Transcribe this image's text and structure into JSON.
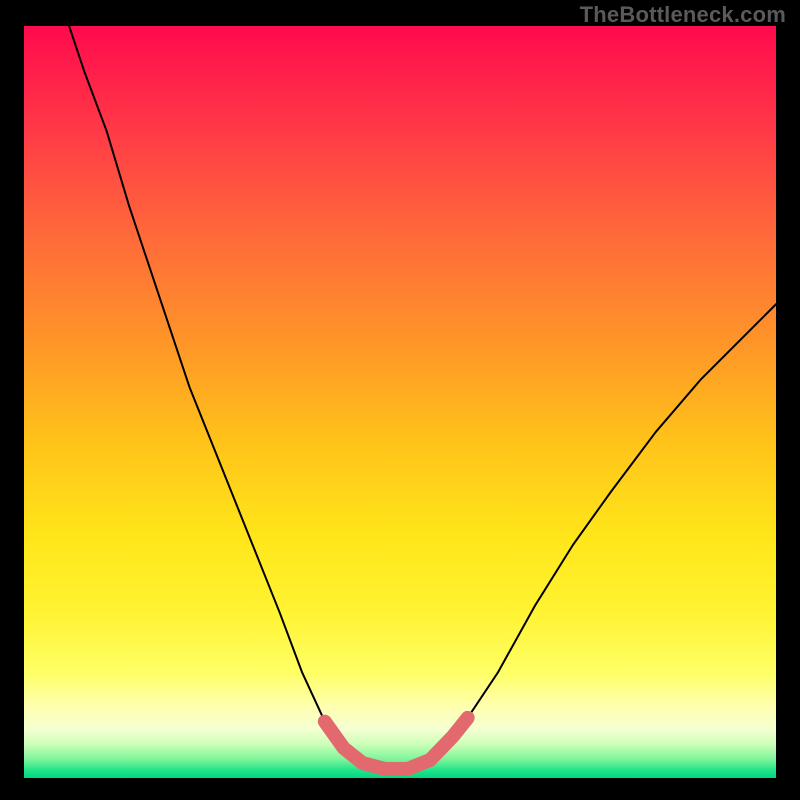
{
  "attribution": "TheBottleneck.com",
  "chart_data": {
    "type": "line",
    "title": "",
    "xlabel": "",
    "ylabel": "",
    "xlim": [
      0,
      100
    ],
    "ylim": [
      0,
      100
    ],
    "frame": {
      "inner_left": 24,
      "inner_top": 26,
      "inner_width": 752,
      "inner_height": 752
    },
    "background": {
      "kind": "vertical_gradient",
      "stops": [
        {
          "pos": 0.0,
          "color": "#ff0a4d"
        },
        {
          "pos": 0.14,
          "color": "#ff3a47"
        },
        {
          "pos": 0.28,
          "color": "#ff6a3a"
        },
        {
          "pos": 0.42,
          "color": "#ff9528"
        },
        {
          "pos": 0.55,
          "color": "#ffc21a"
        },
        {
          "pos": 0.68,
          "color": "#ffe61a"
        },
        {
          "pos": 0.78,
          "color": "#fff333"
        },
        {
          "pos": 0.86,
          "color": "#ffff66"
        },
        {
          "pos": 0.905,
          "color": "#ffffb0"
        },
        {
          "pos": 0.935,
          "color": "#f5ffd2"
        },
        {
          "pos": 0.955,
          "color": "#ccffb8"
        },
        {
          "pos": 0.975,
          "color": "#7ff59a"
        },
        {
          "pos": 0.99,
          "color": "#1fe38a"
        },
        {
          "pos": 1.0,
          "color": "#00d884"
        }
      ]
    },
    "series": [
      {
        "name": "curve",
        "stroke": "#000000",
        "stroke_width": 2,
        "points_xy_pct": [
          [
            6.0,
            100.0
          ],
          [
            8.0,
            94.0
          ],
          [
            11.0,
            86.0
          ],
          [
            14.0,
            76.0
          ],
          [
            18.0,
            64.0
          ],
          [
            22.0,
            52.0
          ],
          [
            26.0,
            42.0
          ],
          [
            30.0,
            32.0
          ],
          [
            34.0,
            22.0
          ],
          [
            37.0,
            14.0
          ],
          [
            40.0,
            7.5
          ],
          [
            42.5,
            4.0
          ],
          [
            45.0,
            2.0
          ],
          [
            48.0,
            1.2
          ],
          [
            51.0,
            1.2
          ],
          [
            54.0,
            2.4
          ],
          [
            57.0,
            5.5
          ],
          [
            59.0,
            8.0
          ],
          [
            63.0,
            14.0
          ],
          [
            68.0,
            23.0
          ],
          [
            73.0,
            31.0
          ],
          [
            78.0,
            38.0
          ],
          [
            84.0,
            46.0
          ],
          [
            90.0,
            53.0
          ],
          [
            96.0,
            59.0
          ],
          [
            100.0,
            63.0
          ]
        ]
      },
      {
        "name": "trough-highlight",
        "stroke": "#e26a6f",
        "stroke_width": 14,
        "points_xy_pct": [
          [
            40.0,
            7.5
          ],
          [
            42.5,
            4.0
          ],
          [
            45.0,
            2.0
          ],
          [
            48.0,
            1.2
          ],
          [
            51.0,
            1.2
          ],
          [
            54.0,
            2.4
          ],
          [
            57.0,
            5.5
          ],
          [
            59.0,
            8.0
          ]
        ]
      }
    ]
  }
}
